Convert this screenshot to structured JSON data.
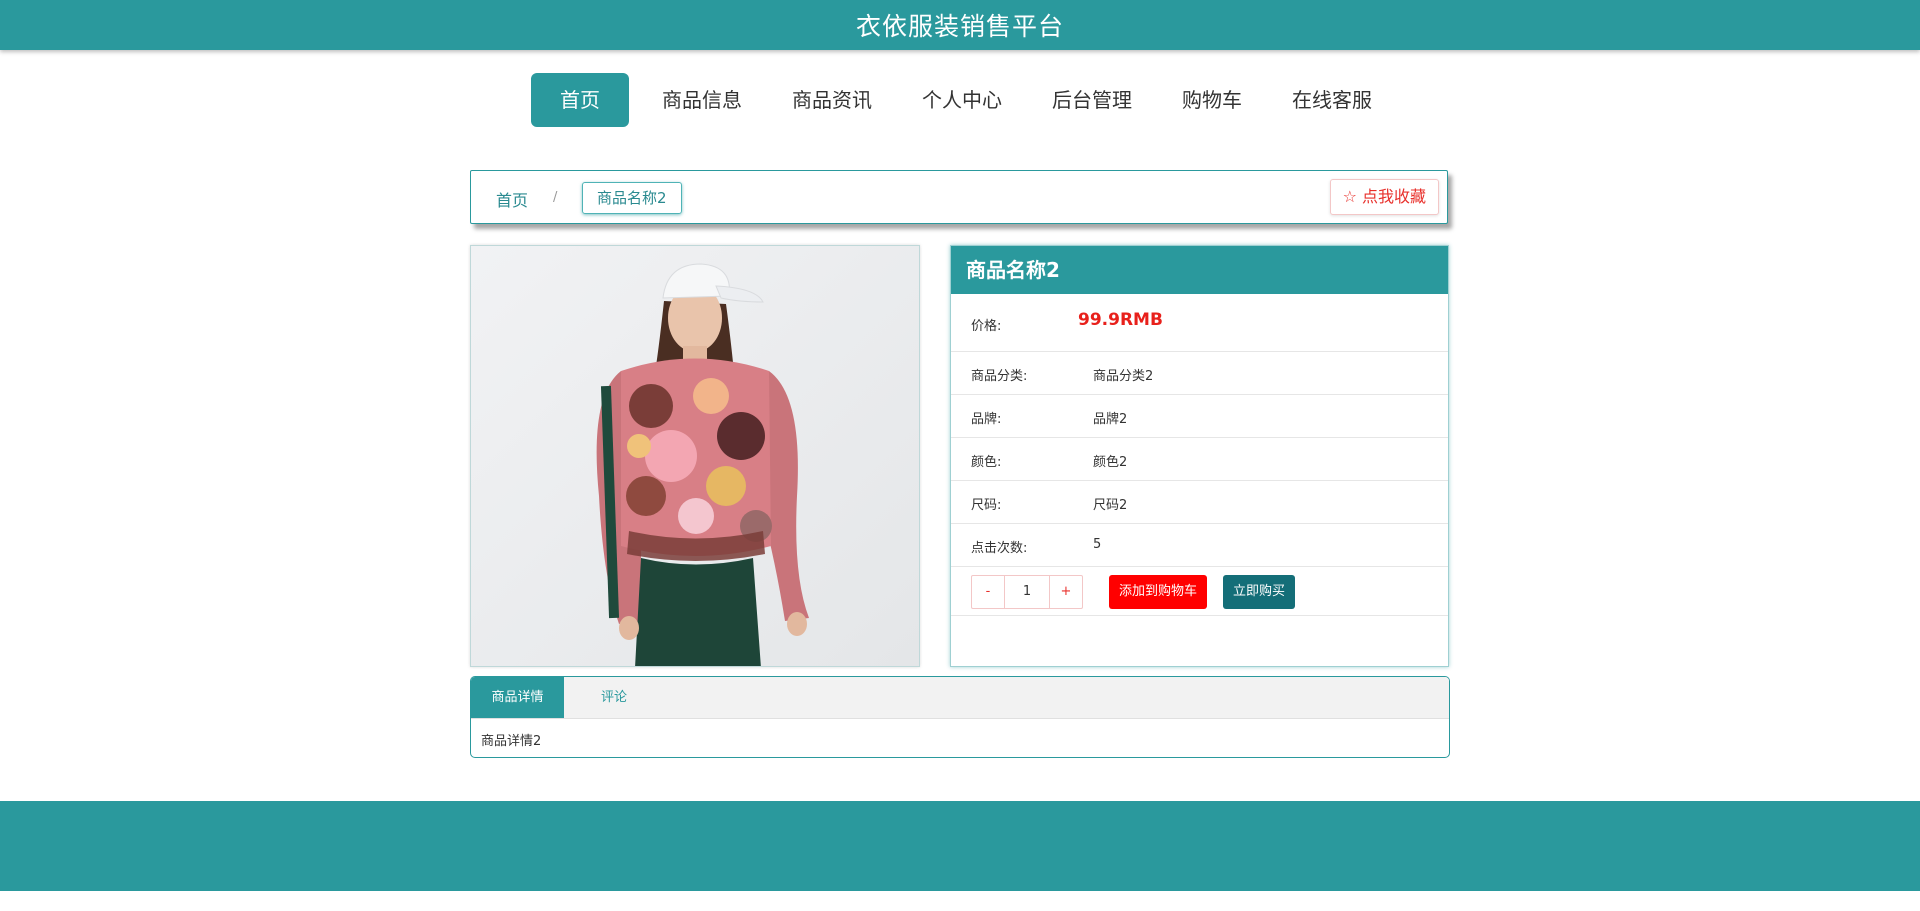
{
  "header": {
    "title": "衣依服装销售平台"
  },
  "nav": {
    "items": [
      {
        "label": "首页",
        "active": true
      },
      {
        "label": "商品信息"
      },
      {
        "label": "商品资讯"
      },
      {
        "label": "个人中心"
      },
      {
        "label": "后台管理"
      },
      {
        "label": "购物车"
      },
      {
        "label": "在线客服"
      }
    ]
  },
  "breadcrumb": {
    "home": "首页",
    "separator": "/",
    "current": "商品名称2",
    "favorite": "☆ 点我收藏"
  },
  "product": {
    "name": "商品名称2",
    "price_label": "价格:",
    "price": "99.9RMB",
    "fields": [
      {
        "label": "商品分类:",
        "value": "商品分类2"
      },
      {
        "label": "品牌:",
        "value": "品牌2"
      },
      {
        "label": "颜色:",
        "value": "颜色2"
      },
      {
        "label": "尺码:",
        "value": "尺码2"
      },
      {
        "label": "点击次数:",
        "value": "5"
      }
    ],
    "quantity": {
      "minus": "-",
      "value": "1",
      "plus": "+"
    },
    "add_to_cart": "添加到购物车",
    "buy_now": "立即购买"
  },
  "tabs": {
    "items": [
      "商品详情",
      "评论"
    ],
    "content": "商品详情2"
  },
  "colors": {
    "primary": "#2a999d",
    "price": "#e8201b",
    "cart_button": "#ff0000",
    "buy_button": "#146e78"
  }
}
